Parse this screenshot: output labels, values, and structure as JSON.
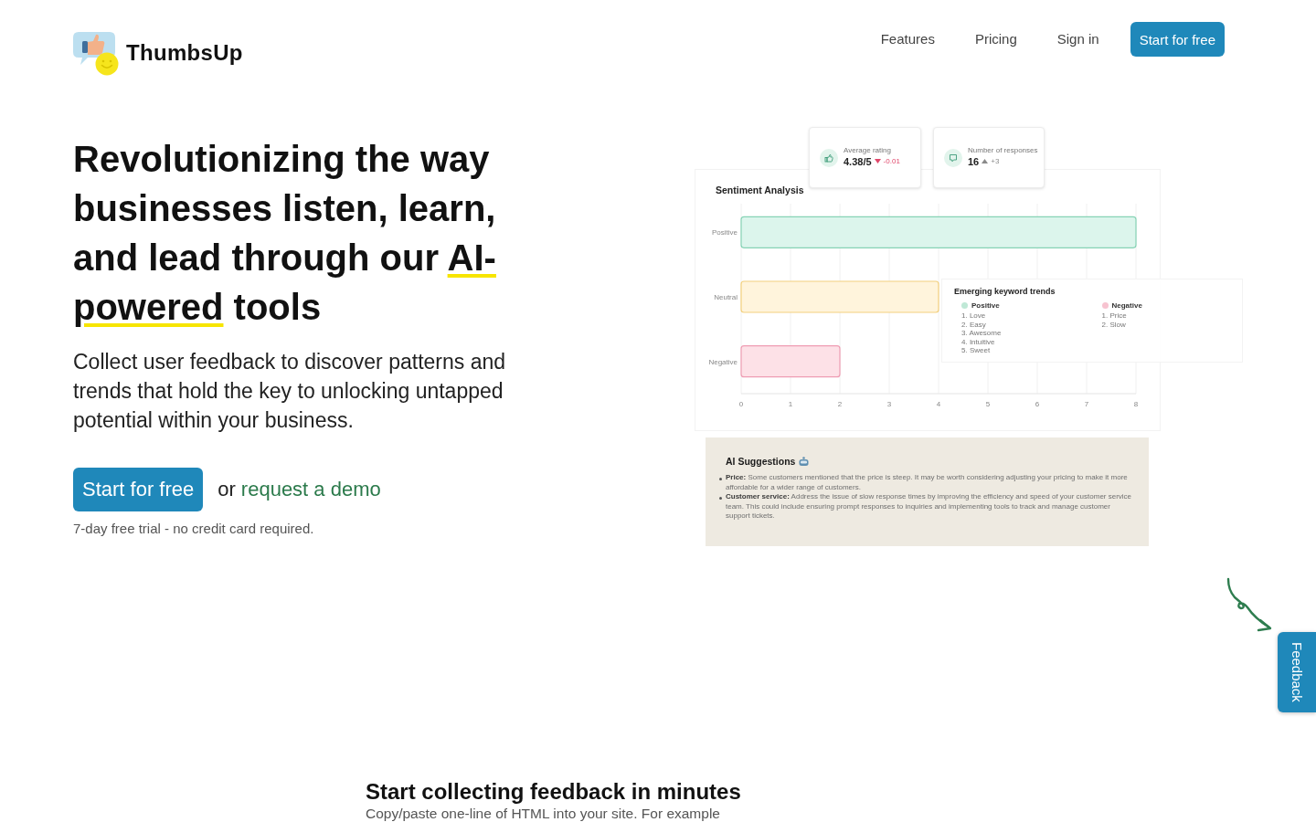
{
  "header": {
    "logo_text": "ThumbsUp",
    "nav_links": [
      "Features",
      "Pricing",
      "Sign in"
    ],
    "cta_button": "Start for free"
  },
  "hero": {
    "title": {
      "before": "Revolutionizing the way businesses listen, learn, and lead through our ",
      "highlight": "AI-powered",
      "after": " tools"
    },
    "description": "Collect user feedback to discover patterns and trends that hold the key to unlocking untapped potential within your business.",
    "cta_button": "Start for free",
    "or_text": "or",
    "demo_link": "request a demo",
    "trial_note": "7-day free trial - no credit card required."
  },
  "dashboard_preview": {
    "stat_cards": [
      {
        "kind": "rating",
        "label": "Average rating",
        "value": "4.38/5",
        "decreased": true,
        "change": "-0.01"
      },
      {
        "kind": "responses",
        "label": "Number of responses",
        "value": "16",
        "decreased": false,
        "change": "+3"
      }
    ],
    "sentiment": {
      "chart_data": {
        "type": "bar",
        "title": "Sentiment Analysis",
        "orientation": "horizontal",
        "categories": [
          "Positive",
          "Neutral",
          "Negative"
        ],
        "values": [
          8,
          4,
          2
        ],
        "xlim": [
          0,
          8
        ],
        "xticks": [
          0,
          1,
          2,
          3,
          4,
          5,
          6,
          7,
          8
        ],
        "grid": true
      }
    },
    "keyword_trends": {
      "title": "Emerging keyword trends",
      "groups": [
        {
          "kind": "positive",
          "label": "Positive",
          "items": [
            "1. Love",
            "2. Easy",
            "3. Awesome",
            "4. Intuitive",
            "5. Sweet"
          ]
        },
        {
          "kind": "negative",
          "label": "Negative",
          "items": [
            "1. Price",
            "2. Slow"
          ]
        }
      ]
    },
    "ai_suggestions": {
      "title": "AI Suggestions",
      "items": [
        "**Price:** Some customers mentioned that the price is steep. It may be worth considering adjusting your pricing to make it more affordable for a wider range of customers.",
        "**Customer service:** Address the issue of slow response times by improving the efficiency and speed of your customer service team. This could include ensuring prompt responses to inquiries and implementing tools to track and manage customer support tickets."
      ]
    }
  },
  "feedback_tab": {
    "label": "Feedback"
  },
  "section": {
    "title": "Start collecting feedback in minutes",
    "subtitle": "Copy/paste one-line of HTML into your site. For example"
  }
}
